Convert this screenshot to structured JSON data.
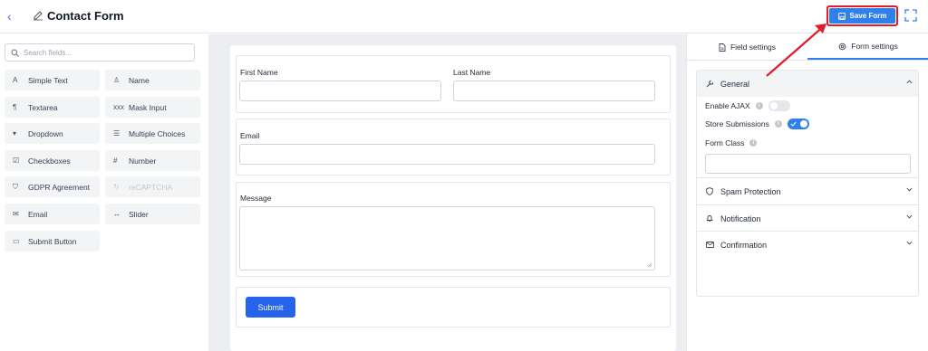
{
  "header": {
    "back_icon": "chevron-left-icon",
    "edit_icon": "edit-icon",
    "title": "Contact Form",
    "save_label": "Save Form",
    "save_icon": "save-icon",
    "expand_icon": "expand-icon"
  },
  "sidebar": {
    "search_placeholder": "Search fields...",
    "fields": [
      {
        "label": "Simple Text",
        "icon": "text-icon",
        "glyph": "A"
      },
      {
        "label": "Name",
        "icon": "user-icon",
        "glyph": "♙"
      },
      {
        "label": "Textarea",
        "icon": "paragraph-icon",
        "glyph": "¶"
      },
      {
        "label": "Mask Input",
        "icon": "mask-icon",
        "glyph": "xxx"
      },
      {
        "label": "Dropdown",
        "icon": "dropdown-icon",
        "glyph": "▾"
      },
      {
        "label": "Multiple Choices",
        "icon": "list-icon",
        "glyph": "☰"
      },
      {
        "label": "Checkboxes",
        "icon": "checkbox-icon",
        "glyph": "☑"
      },
      {
        "label": "Number",
        "icon": "hash-icon",
        "glyph": "#"
      },
      {
        "label": "GDPR Agreement",
        "icon": "shield-icon",
        "glyph": "⛉"
      },
      {
        "label": "reCAPTCHA",
        "icon": "recaptcha-icon",
        "glyph": "↻"
      },
      {
        "label": "Email",
        "icon": "mail-icon",
        "glyph": "✉"
      },
      {
        "label": "Slider",
        "icon": "slider-icon",
        "glyph": "↔"
      },
      {
        "label": "Submit Button",
        "icon": "button-icon",
        "glyph": "▭"
      }
    ]
  },
  "form": {
    "first_name_label": "First Name",
    "last_name_label": "Last Name",
    "email_label": "Email",
    "message_label": "Message",
    "submit_label": "Submit"
  },
  "settings": {
    "tabs": [
      {
        "label": "Field settings",
        "icon": "file-icon",
        "active": false
      },
      {
        "label": "Form settings",
        "icon": "gear-icon",
        "active": true
      }
    ],
    "general": {
      "title": "General",
      "icon": "wrench-icon",
      "enable_ajax_label": "Enable AJAX",
      "enable_ajax": false,
      "store_submissions_label": "Store Submissions",
      "store_submissions": true,
      "form_class_label": "Form Class",
      "form_class_value": ""
    },
    "sections": [
      {
        "title": "Spam Protection",
        "icon": "shield-icon"
      },
      {
        "title": "Notification",
        "icon": "bell-icon"
      },
      {
        "title": "Confirmation",
        "icon": "mail-icon"
      }
    ]
  },
  "colors": {
    "accent": "#2f80ed",
    "submit": "#2563eb",
    "highlight": "#e11d2a"
  }
}
